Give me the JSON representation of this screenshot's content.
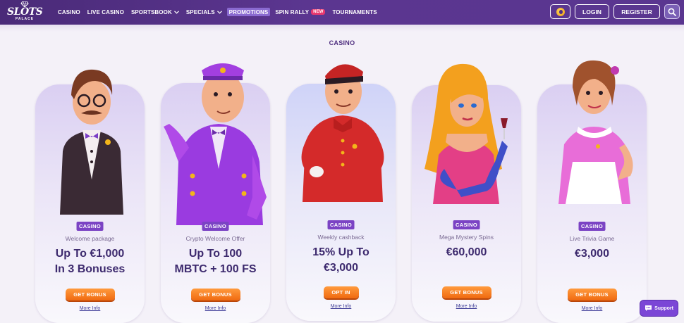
{
  "logo": {
    "word": "SLOTS",
    "sub": "PALACE"
  },
  "nav": {
    "items": [
      {
        "label": "CASINO",
        "chevron": false
      },
      {
        "label": "LIVE CASINO",
        "chevron": false
      },
      {
        "label": "SPORTSBOOK",
        "chevron": true
      },
      {
        "label": "SPECIALS",
        "chevron": true
      },
      {
        "label": "PROMOTIONS",
        "chevron": false,
        "active": true
      },
      {
        "label": "SPIN RALLY",
        "chevron": false,
        "badge": "NEW"
      },
      {
        "label": "TOURNAMENTS",
        "chevron": false
      }
    ]
  },
  "header": {
    "login": "LOGIN",
    "register": "REGISTER"
  },
  "section": {
    "title": "CASINO"
  },
  "cards": [
    {
      "tag": "CASINO",
      "subtitle": "Welcome package",
      "line1": "Up To €1,000",
      "line2": "In 3 Bonuses",
      "cta": "GET BONUS",
      "more": "More Info"
    },
    {
      "tag": "CASINO",
      "subtitle": "Crypto Welcome Offer",
      "line1": "Up To 100",
      "line2": "MBTC + 100 FS",
      "cta": "GET BONUS",
      "more": "More Info"
    },
    {
      "tag": "CASINO",
      "subtitle": "Weekly cashback",
      "line1": "15% Up To",
      "line2": "€3,000",
      "cta": "OPT IN",
      "more": "More Info"
    },
    {
      "tag": "CASINO",
      "subtitle": "Mega Mystery Spins",
      "line1": "€60,000",
      "line2": "",
      "cta": "GET BONUS",
      "more": "More Info"
    },
    {
      "tag": "CASINO",
      "subtitle": "Live Trivia Game",
      "line1": "€3,000",
      "line2": "",
      "cta": "GET BONUS",
      "more": "More Info"
    }
  ],
  "support": {
    "label": "Support"
  },
  "colors": {
    "header": "#4a2a78",
    "accent": "#7b43c4",
    "cta": "#f06a10",
    "headline": "#3d2a6e"
  },
  "icons": [
    "diamond-logo-icon",
    "chevron-down-icon",
    "coin-icon",
    "search-icon",
    "chat-bubble-icon"
  ]
}
